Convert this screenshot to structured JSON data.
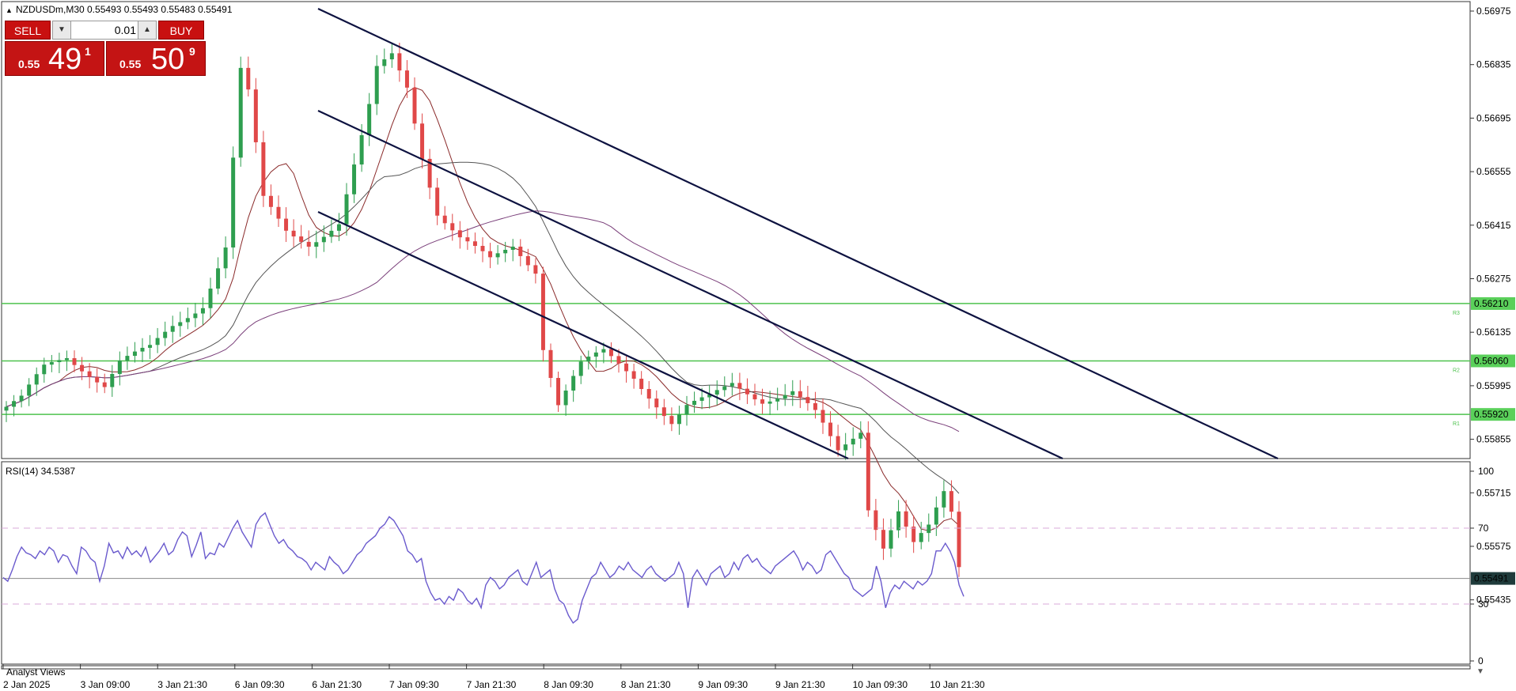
{
  "header": {
    "symbol_line": "NZDUSDm,M30  0.55493 0.55493 0.55483 0.55491",
    "collapse_icon": "triangle-up-icon"
  },
  "trade_panel": {
    "sell_label": "SELL",
    "buy_label": "BUY",
    "lot_value": "0.01",
    "sell_price_small": "0.55",
    "sell_price_big": "49",
    "sell_price_sup": "1",
    "buy_price_small": "0.55",
    "buy_price_big": "50",
    "buy_price_sup": "9",
    "color": "#c41414"
  },
  "rsi_label": "RSI(14) 34.5387",
  "bottom_text": "Analyst Views",
  "chart_data": [
    {
      "type": "candlestick",
      "symbol": "NZDUSDm",
      "timeframe": "M30",
      "ylim": [
        0.5538,
        0.5699
      ],
      "y_ticks": [
        "0.56975",
        "0.56835",
        "0.56695",
        "0.56555",
        "0.56415",
        "0.56275",
        "0.56135",
        "0.55995",
        "0.55855",
        "0.55715",
        "0.55575",
        "0.55435"
      ],
      "x_labels": [
        "2 Jan 2025",
        "3 Jan 09:00",
        "3 Jan 21:30",
        "6 Jan 09:30",
        "6 Jan 21:30",
        "7 Jan 09:30",
        "7 Jan 21:30",
        "8 Jan 09:30",
        "8 Jan 21:30",
        "9 Jan 09:30",
        "9 Jan 21:30",
        "10 Jan 09:30",
        "10 Jan 21:30"
      ],
      "price_path": [
        [
          0,
          0.5594
        ],
        [
          2,
          0.5596
        ],
        [
          5,
          0.5604
        ],
        [
          8,
          0.5607
        ],
        [
          11,
          0.5603
        ],
        [
          13,
          0.56
        ],
        [
          15,
          0.5606
        ],
        [
          19,
          0.5609
        ],
        [
          22,
          0.5615
        ],
        [
          26,
          0.5621
        ],
        [
          29,
          0.5636
        ],
        [
          31,
          0.5682
        ],
        [
          32,
          0.5676
        ],
        [
          34,
          0.5648
        ],
        [
          37,
          0.564
        ],
        [
          40,
          0.5637
        ],
        [
          44,
          0.5642
        ],
        [
          47,
          0.5664
        ],
        [
          48,
          0.5672
        ],
        [
          49,
          0.5682
        ],
        [
          51,
          0.5686
        ],
        [
          53,
          0.5678
        ],
        [
          55,
          0.566
        ],
        [
          57,
          0.5645
        ],
        [
          60,
          0.5638
        ],
        [
          64,
          0.5632
        ],
        [
          67,
          0.5636
        ],
        [
          70,
          0.563
        ],
        [
          71,
          0.561
        ],
        [
          73,
          0.5595
        ],
        [
          76,
          0.5605
        ],
        [
          79,
          0.5608
        ],
        [
          83,
          0.5602
        ],
        [
          86,
          0.5595
        ],
        [
          88,
          0.559
        ],
        [
          90,
          0.5594
        ],
        [
          93,
          0.5596
        ],
        [
          96,
          0.56
        ],
        [
          100,
          0.5596
        ],
        [
          104,
          0.5598
        ],
        [
          107,
          0.5592
        ],
        [
          110,
          0.5582
        ],
        [
          113,
          0.5588
        ],
        [
          114,
          0.5568
        ],
        [
          116,
          0.5558
        ],
        [
          118,
          0.5567
        ],
        [
          120,
          0.5558
        ],
        [
          122,
          0.5562
        ],
        [
          124,
          0.5571
        ],
        [
          125,
          0.5566
        ],
        [
          126,
          0.5552
        ]
      ],
      "current_price": "0.55491",
      "horizontal_levels": [
        {
          "price": 0.5621,
          "label": "0.56210",
          "tag": "R3",
          "color": "#4ec24e"
        },
        {
          "price": 0.5606,
          "label": "0.56060",
          "tag": "R2",
          "color": "#4ec24e"
        },
        {
          "price": 0.5592,
          "label": "0.55920",
          "tag": "R1",
          "color": "#4ec24e"
        }
      ],
      "channel_color": "#0d1240",
      "bull_color": "#2e9e4f",
      "bear_color": "#e04848"
    },
    {
      "type": "line",
      "name": "RSI(14)",
      "current": 34.5387,
      "ylim": [
        0,
        100
      ],
      "y_ticks": [
        "100",
        "70",
        "30",
        "0"
      ],
      "levels": [
        70,
        30
      ],
      "line_color": "#6a5acd",
      "values": [
        44,
        42,
        48,
        55,
        60,
        57,
        56,
        54,
        58,
        56,
        60,
        58,
        52,
        56,
        55,
        50,
        46,
        60,
        58,
        54,
        52,
        42,
        50,
        62,
        57,
        58,
        54,
        60,
        56,
        58,
        55,
        60,
        52,
        55,
        58,
        62,
        56,
        58,
        64,
        68,
        66,
        55,
        61,
        68,
        54,
        57,
        56,
        62,
        60,
        65,
        70,
        74,
        68,
        64,
        60,
        72,
        76,
        78,
        72,
        66,
        62,
        64,
        60,
        58,
        55,
        54,
        52,
        48,
        52,
        50,
        48,
        55,
        52,
        50,
        46,
        48,
        52,
        56,
        58,
        62,
        64,
        66,
        70,
        72,
        76,
        74,
        70,
        66,
        58,
        56,
        52,
        54,
        42,
        36,
        32,
        33,
        30,
        34,
        32,
        38,
        36,
        32,
        30,
        33,
        28,
        40,
        44,
        42,
        38,
        40,
        44,
        46,
        48,
        42,
        40,
        46,
        52,
        44,
        46,
        48,
        38,
        32,
        30,
        24,
        20,
        22,
        32,
        38,
        44,
        46,
        52,
        48,
        44,
        46,
        50,
        48,
        52,
        48,
        46,
        44,
        48,
        50,
        46,
        44,
        42,
        44,
        46,
        52,
        46,
        28,
        44,
        48,
        44,
        40,
        46,
        48,
        50,
        44,
        46,
        52,
        48,
        54,
        56,
        52,
        54,
        50,
        48,
        46,
        50,
        52,
        54,
        56,
        58,
        54,
        48,
        52,
        50,
        46,
        48,
        56,
        58,
        54,
        50,
        46,
        44,
        38,
        36,
        34,
        36,
        38,
        50,
        42,
        28,
        36,
        40,
        38,
        42,
        40,
        38,
        42,
        40,
        42,
        46,
        58,
        58,
        62,
        58,
        52,
        40,
        34
      ]
    }
  ]
}
